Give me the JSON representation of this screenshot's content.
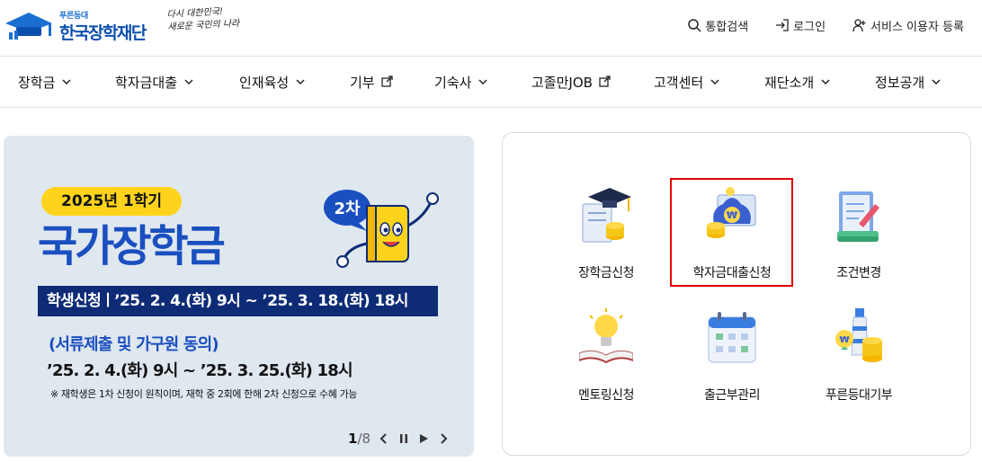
{
  "header": {
    "logo": {
      "sub": "푸른등대",
      "main": "한국장학재단"
    },
    "slogan": [
      "다시 대한민국!",
      "새로운 국민의 나라"
    ],
    "util": [
      {
        "label": "통합검색",
        "icon": "search-icon"
      },
      {
        "label": "로그인",
        "icon": "login-icon"
      },
      {
        "label": "서비스 이용자 등록",
        "icon": "user-add-icon"
      }
    ]
  },
  "gnb": {
    "items": [
      {
        "label": "장학금",
        "icon": "chevron-down-icon"
      },
      {
        "label": "학자금대출",
        "icon": "chevron-down-icon"
      },
      {
        "label": "인재육성",
        "icon": "chevron-down-icon"
      },
      {
        "label": "기부",
        "icon": "external-link-icon"
      },
      {
        "label": "기숙사",
        "icon": "chevron-down-icon"
      },
      {
        "label": "고졸만JOB",
        "icon": "external-link-icon"
      },
      {
        "label": "고객센터",
        "icon": "chevron-down-icon"
      },
      {
        "label": "재단소개",
        "icon": "chevron-down-icon"
      },
      {
        "label": "정보공개",
        "icon": "chevron-down-icon"
      }
    ]
  },
  "banner": {
    "badge": "2025년 1학기",
    "round_badge": "2차",
    "title": "국가장학금",
    "period": "학생신청ㅣ’25. 2. 4.(화) 9시 ~ ’25. 3. 18.(화) 18시",
    "sub_title": "(서류제출 및 가구원 동의)",
    "sub_period": "’25. 2. 4.(화) 9시 ~ ’25. 3. 25.(화) 18시",
    "note": "※ 재학생은 1차 신청이 원칙이며, 재학 중 2회에 한해 2차 신청으로 수혜 가능",
    "pager": {
      "current": "1",
      "total": "/8"
    }
  },
  "quick_menu": {
    "items": [
      {
        "label": "장학금신청",
        "icon": "graduation-cap-icon"
      },
      {
        "label": "학자금대출신청",
        "icon": "money-bag-icon",
        "highlighted": true
      },
      {
        "label": "조건변경",
        "icon": "document-edit-icon"
      },
      {
        "label": "멘토링신청",
        "icon": "lightbulb-book-icon"
      },
      {
        "label": "출근부관리",
        "icon": "calendar-icon"
      },
      {
        "label": "푸른등대기부",
        "icon": "lighthouse-coins-icon"
      }
    ]
  },
  "colors": {
    "brand_blue": "#1a4fbf",
    "navy": "#0e2c76",
    "yellow": "#ffd31c",
    "banner_bg": "#dfe7ef",
    "highlight_red": "#e00000"
  }
}
